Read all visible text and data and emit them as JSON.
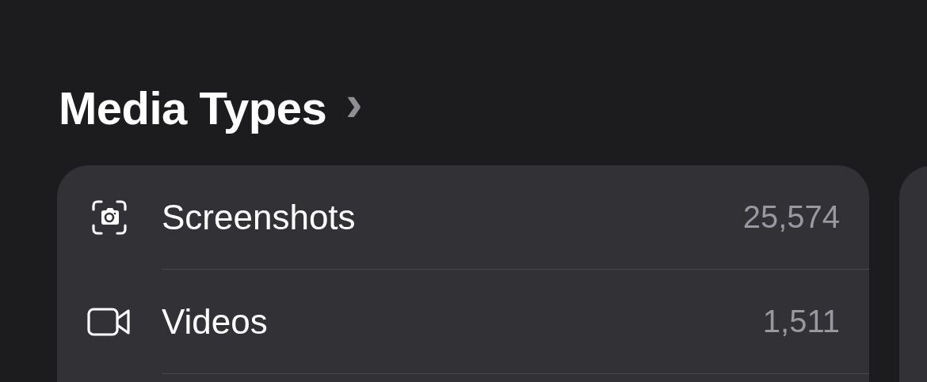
{
  "section": {
    "title": "Media Types",
    "chevron": "›"
  },
  "rows": [
    {
      "kind": "screenshot",
      "label": "Screenshots",
      "count": "25,574"
    },
    {
      "kind": "video",
      "label": "Videos",
      "count": "1,511"
    }
  ]
}
